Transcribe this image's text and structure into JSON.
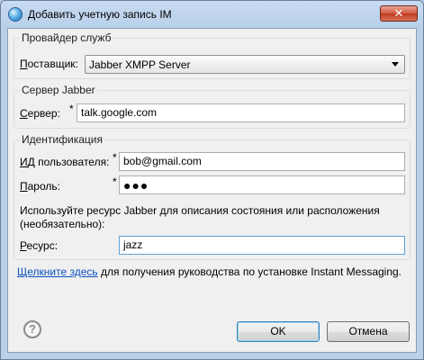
{
  "window": {
    "title": "Добавить учетную запись IM",
    "close_glyph": "✕",
    "app_icon": "globe-icon"
  },
  "provider_group": {
    "legend": "Провайдер служб",
    "label_underlined": "П",
    "label_rest": "оставщик:",
    "select_value": "Jabber XMPP Server"
  },
  "server_group": {
    "legend": "Сервер Jabber",
    "label_underlined": "С",
    "label_rest": "ервер:",
    "required_mark": "*",
    "value": "talk.google.com"
  },
  "ident_group": {
    "legend": "Идентификация",
    "user_label_underlined": "И",
    "user_label_rest": "Д пользователя:",
    "user_required": "*",
    "user_value": "bob@gmail.com",
    "password_label_underlined": "П",
    "password_label_rest": "ароль:",
    "password_required": "*",
    "password_value": "●●●",
    "resource_note": "Используйте ресурс Jabber для описания состояния или расположения (необязательно):",
    "resource_label_underlined": "Р",
    "resource_label_rest": "есурс:",
    "resource_value": "jazz"
  },
  "footer": {
    "link_text": "Щелкните здесь",
    "link_rest": " для получения руководства по установке Instant Messaging.",
    "help_glyph": "?",
    "ok_label": "OK",
    "cancel_label": "Отмена"
  }
}
